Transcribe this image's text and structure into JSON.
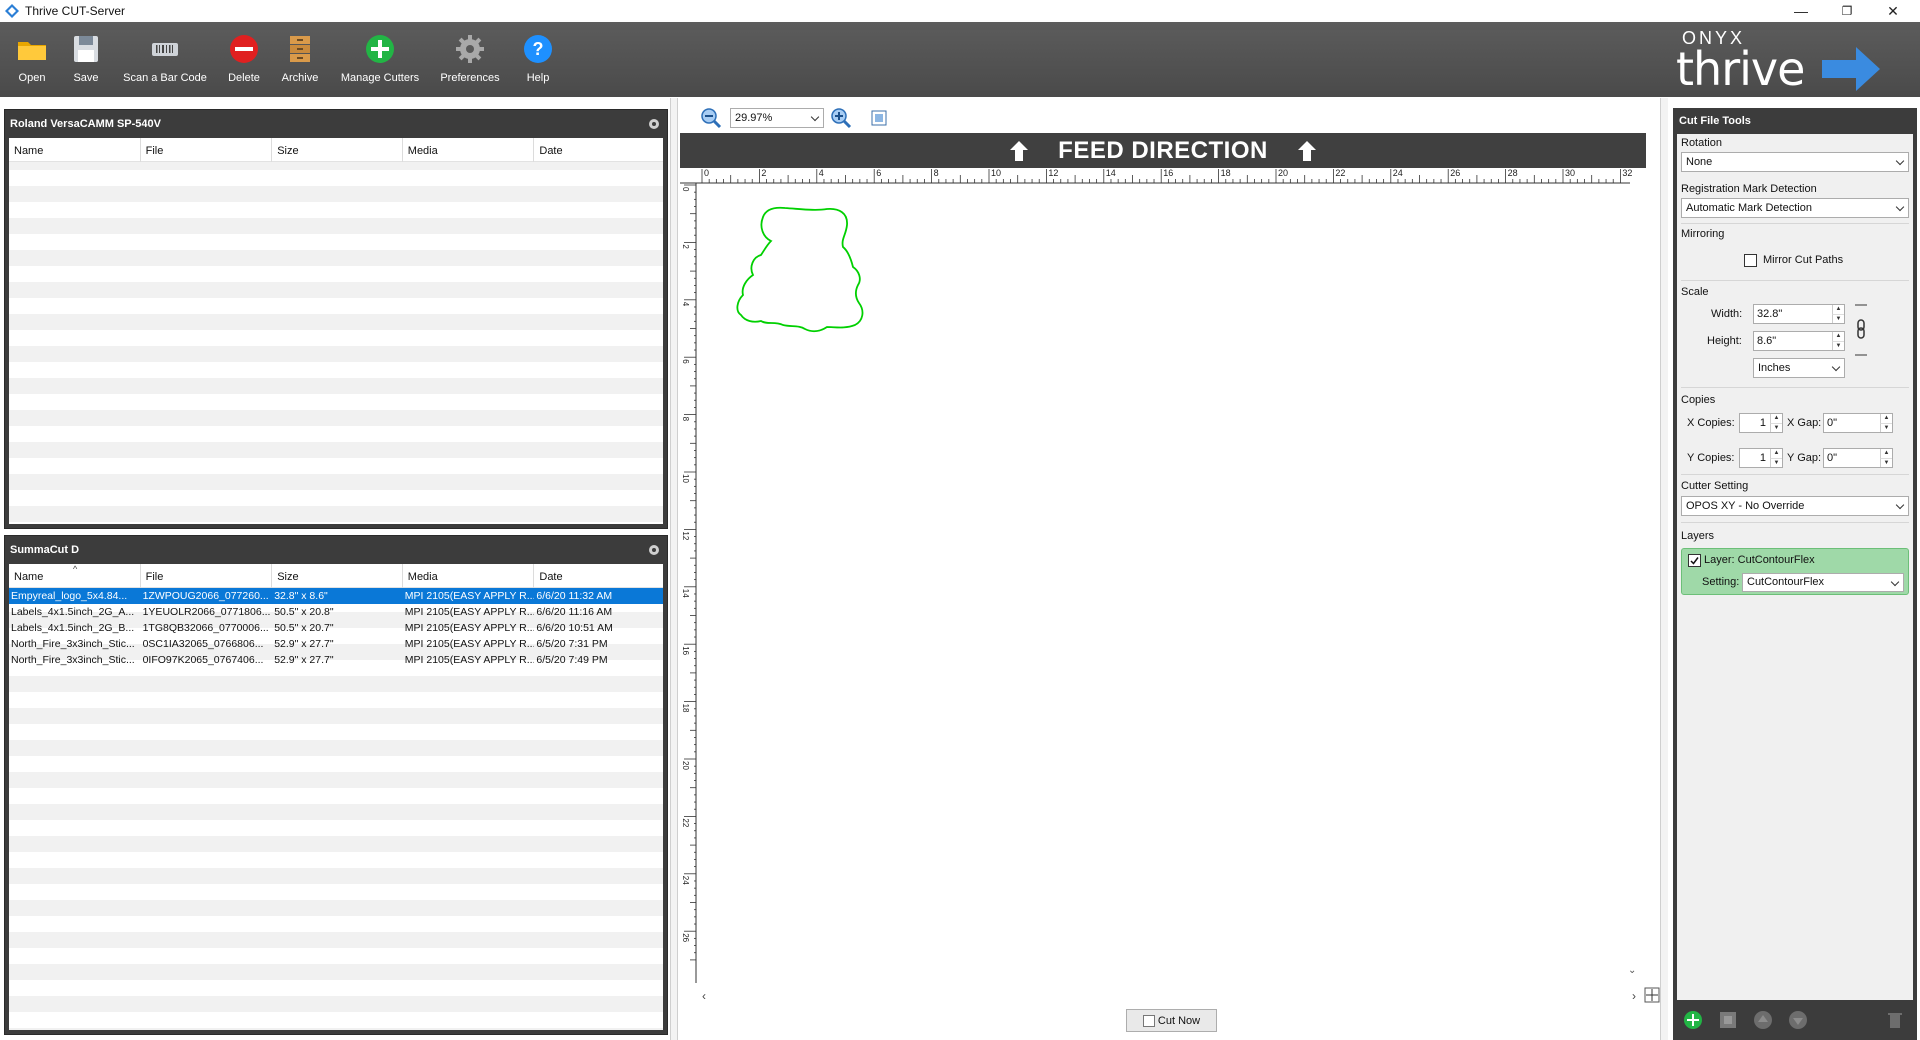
{
  "window": {
    "title": "Thrive CUT-Server",
    "minimize": "—",
    "restore": "❐",
    "close": "✕"
  },
  "toolbar": {
    "buttons": [
      {
        "label": "Open",
        "icon": "folder-icon"
      },
      {
        "label": "Save",
        "icon": "floppy-disk-icon"
      },
      {
        "label": "Scan a Bar Code",
        "icon": "barcode-scanner-icon"
      },
      {
        "label": "Delete",
        "icon": "delete-icon"
      },
      {
        "label": "Archive",
        "icon": "archive-icon"
      },
      {
        "label": "Manage Cutters",
        "icon": "add-icon"
      },
      {
        "label": "Preferences",
        "icon": "gear-icon"
      },
      {
        "label": "Help",
        "icon": "help-icon"
      }
    ],
    "logo": {
      "brand": "ONYX",
      "product": "thrive"
    }
  },
  "queues": [
    {
      "name": "Roland VersaCAMM SP-540V",
      "columns": [
        "Name",
        "File",
        "Size",
        "Media",
        "Date"
      ],
      "rows": []
    },
    {
      "name": "SummaCut D",
      "columns": [
        "Name",
        "File",
        "Size",
        "Media",
        "Date"
      ],
      "sort_indicator": "^",
      "rows": [
        {
          "name": "Empyreal_logo_5x4.84...",
          "file": "1ZWPOUG2066_077260...",
          "size": "32.8\" x 8.6\"",
          "media": "MPI 2105(EASY APPLY R...",
          "date": "6/6/20 11:32 AM",
          "selected": true
        },
        {
          "name": "Labels_4x1.5inch_2G_A...",
          "file": "1YEUOLR2066_0771806...",
          "size": "50.5\" x 20.8\"",
          "media": "MPI 2105(EASY APPLY R...",
          "date": "6/6/20 11:16 AM",
          "selected": false
        },
        {
          "name": "Labels_4x1.5inch_2G_B...",
          "file": "1TG8QB32066_0770006...",
          "size": "50.5\" x 20.7\"",
          "media": "MPI 2105(EASY APPLY R...",
          "date": "6/6/20 10:51 AM",
          "selected": false
        },
        {
          "name": "North_Fire_3x3inch_Stic...",
          "file": "0SC1IA32065_0766806...",
          "size": "52.9\" x 27.7\"",
          "media": "MPI 2105(EASY APPLY R...",
          "date": "6/5/20 7:31 PM",
          "selected": false
        },
        {
          "name": "North_Fire_3x3inch_Stic...",
          "file": "0IFO97K2065_0767406...",
          "size": "52.9\" x 27.7\"",
          "media": "MPI 2105(EASY APPLY R...",
          "date": "6/5/20 7:49 PM",
          "selected": false
        }
      ]
    }
  ],
  "preview": {
    "zoom": "29.97%",
    "feed_direction": "FEED DIRECTION",
    "ruler_h": [
      "0",
      "2",
      "4",
      "6",
      "8",
      "10",
      "12",
      "14",
      "16",
      "18",
      "20",
      "22",
      "24",
      "26",
      "28",
      "30",
      "32"
    ],
    "ruler_v": [
      "0",
      "2",
      "4",
      "6",
      "8",
      "10",
      "12",
      "14",
      "16",
      "18",
      "20",
      "22",
      "24",
      "26"
    ],
    "cut_now": "Cut Now",
    "contour_color": "#00d000"
  },
  "tools": {
    "title": "Cut File Tools",
    "rotation": {
      "label": "Rotation",
      "value": "None"
    },
    "registration": {
      "label": "Registration Mark Detection",
      "value": "Automatic Mark Detection"
    },
    "mirroring": {
      "label": "Mirroring",
      "checkbox": "Mirror Cut Paths",
      "checked": false
    },
    "scale": {
      "label": "Scale",
      "width_label": "Width:",
      "width": "32.8\"",
      "height_label": "Height:",
      "height": "8.6\"",
      "unit": "Inches"
    },
    "copies": {
      "label": "Copies",
      "x_label": "X Copies:",
      "x": "1",
      "xgap_label": "X Gap:",
      "xgap": "0\"",
      "y_label": "Y Copies:",
      "y": "1",
      "ygap_label": "Y Gap:",
      "ygap": "0\""
    },
    "cutter_setting": {
      "label": "Cutter Setting",
      "value": "OPOS XY - No Override"
    },
    "layers": {
      "label": "Layers",
      "layer_name": "Layer: CutContourFlex",
      "setting_label": "Setting:",
      "setting_value": "CutContourFlex",
      "checked": true
    }
  },
  "colors": {
    "toolbar": "#4f4f4f",
    "panel": "#3c3c3c",
    "selection": "#0a78d7",
    "layer_bg": "#9fd9a8"
  }
}
